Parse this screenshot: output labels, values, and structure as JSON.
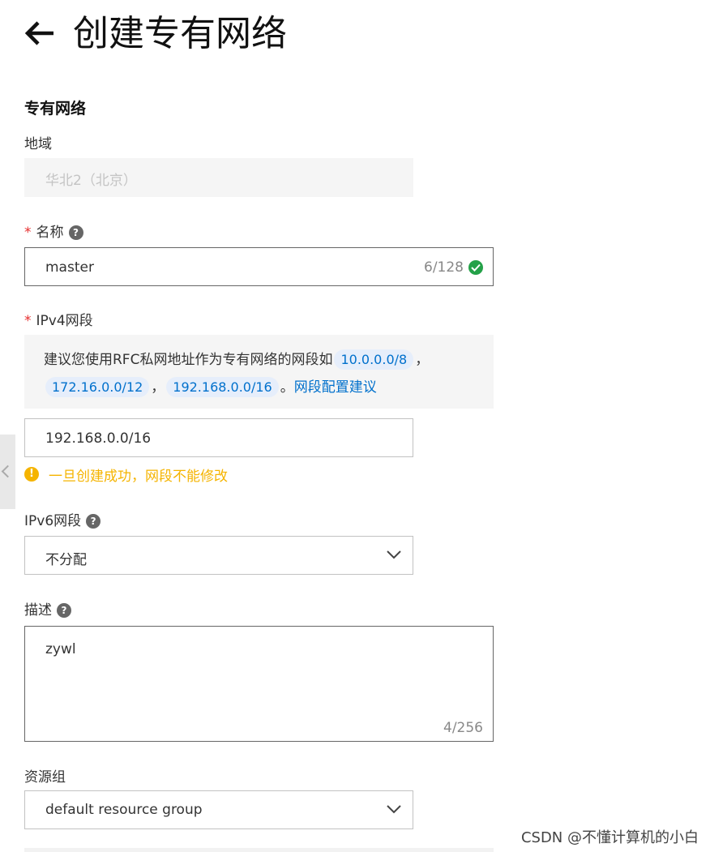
{
  "header": {
    "title": "创建专有网络",
    "back_icon": "arrow-left-icon"
  },
  "section": {
    "title": "专有网络"
  },
  "region": {
    "label": "地域",
    "value": "华北2（北京）"
  },
  "name": {
    "required_mark": "*",
    "label": "名称",
    "value": "master",
    "counter": "6/128",
    "help_icon": "question-icon",
    "status_icon": "check-circle-icon"
  },
  "ipv4": {
    "required_mark": "*",
    "label": "IPv4网段",
    "tip_text": "建议您使用RFC私网地址作为专有网络的网段如",
    "suggestions": [
      "10.0.0.0/8",
      "172.16.0.0/12",
      "192.168.0.0/16"
    ],
    "comma": "，",
    "period": "。",
    "link": "网段配置建议",
    "value": "192.168.0.0/16",
    "warning": "一旦创建成功，网段不能修改",
    "warning_icon": "exclamation-circle-icon"
  },
  "ipv6": {
    "label": "IPv6网段",
    "selected": "不分配",
    "help_icon": "question-icon"
  },
  "description": {
    "label": "描述",
    "value": "zywl",
    "counter": "4/256",
    "help_icon": "question-icon"
  },
  "resource_group": {
    "label": "资源组",
    "selected": "default resource group"
  },
  "watermark": "CSDN @不懂计算机的小白",
  "colors": {
    "accent": "#0070cc",
    "success": "#24a148",
    "warning": "#f5b400",
    "required": "#e62e2e"
  }
}
